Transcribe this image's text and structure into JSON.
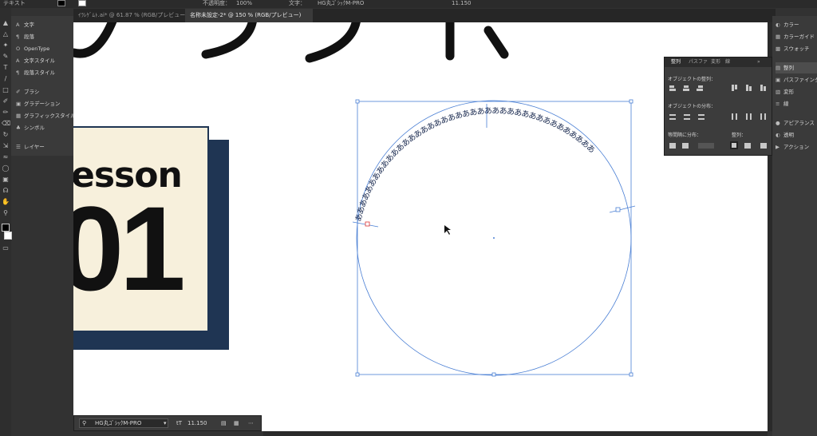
{
  "control_bar": {
    "left_label": "テキスト",
    "opacity_label": "不透明度：",
    "opacity_value": "100%",
    "char_label": "文字：",
    "font_name": "HG丸ｺﾞｼｯｸM-PRO",
    "font_size": "11.150"
  },
  "tabs": [
    "ｲﾗﾚｹﾞﾑﾄ.ai* @ 61.87 % (RGB/プレビュー)",
    "名称未設定-2* @ 150 % (RGB/プレビュー)"
  ],
  "left_panel": {
    "items": [
      "文字",
      "段落",
      "OpenType",
      "文字スタイル",
      "段落スタイル",
      "ブラシ",
      "グラデーション",
      "グラフィックスタイル",
      "シンボル",
      "レイヤー"
    ]
  },
  "canvas": {
    "lesson_word": "esson",
    "lesson_number": "01",
    "path_text": "ああああああああああああああああああああああああああああああああああああああああ"
  },
  "text_control": {
    "font_name": "HG丸ｺﾞｼｯｸM-PRO",
    "size": "11.150"
  },
  "align_panel": {
    "tabs": [
      "整列",
      "パスファ",
      "変形",
      "線"
    ],
    "section_align": "オブジェクトの整列：",
    "section_distribute": "オブジェクトの分布：",
    "section_spacing": "等間隔に分布：",
    "section_align_to": "整列："
  },
  "right_dock": {
    "items": [
      "カラー",
      "カラーガイド",
      "スウォッチ",
      "整列",
      "パスファインダー",
      "変形",
      "線",
      "アピアランス",
      "透明",
      "アクション"
    ]
  },
  "colors": {
    "ui_dark": "#323232",
    "card_bg": "#f7f0dc",
    "card_shadow": "#1f3553",
    "selection_blue": "#4a7fd4"
  }
}
